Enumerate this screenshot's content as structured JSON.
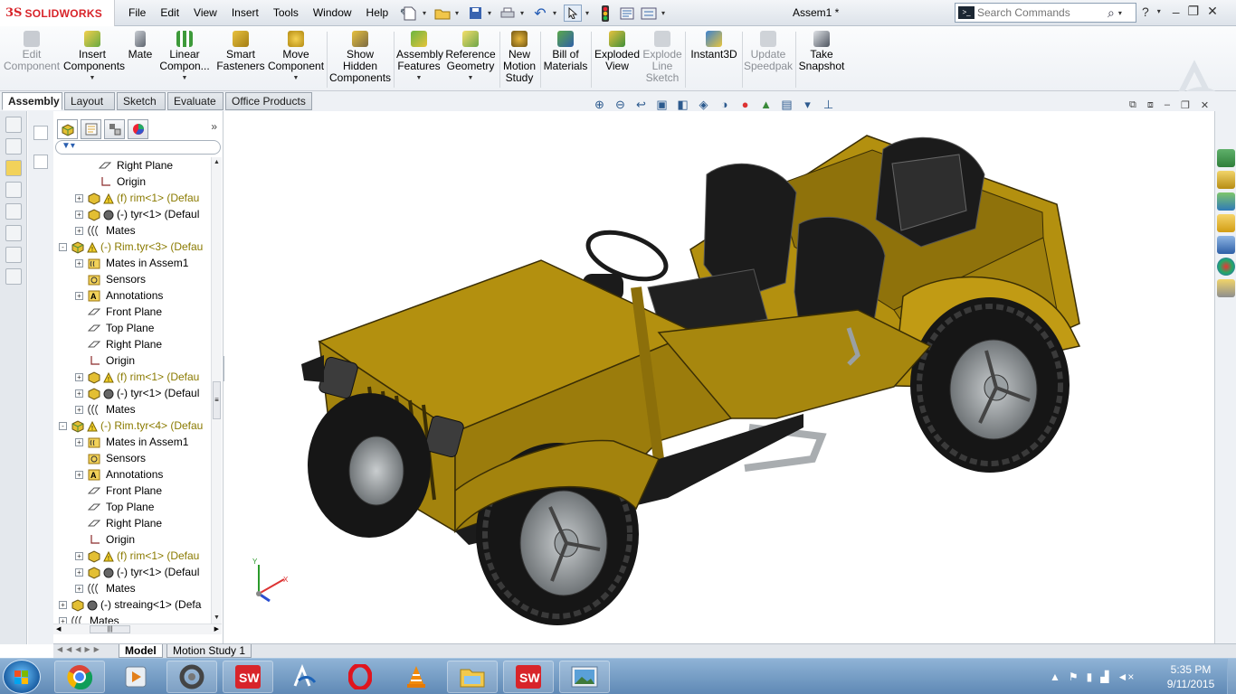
{
  "app": {
    "brand": "SOLIDWORKS",
    "logo_glyph": "3S",
    "document_title": "Assem1 *"
  },
  "menu": [
    "File",
    "Edit",
    "View",
    "Insert",
    "Tools",
    "Window",
    "Help"
  ],
  "search": {
    "placeholder": "Search Commands"
  },
  "ribbon": {
    "edit_component": [
      "Edit",
      "Component"
    ],
    "insert_components": [
      "Insert",
      "Components"
    ],
    "mate": [
      "Mate"
    ],
    "linear_component": [
      "Linear",
      "Compon..."
    ],
    "smart_fasteners": [
      "Smart",
      "Fasteners"
    ],
    "move_component": [
      "Move",
      "Component"
    ],
    "show_hidden": [
      "Show",
      "Hidden",
      "Components"
    ],
    "assembly_features": [
      "Assembly",
      "Features"
    ],
    "reference_geometry": [
      "Reference",
      "Geometry"
    ],
    "new_motion_study": [
      "New",
      "Motion",
      "Study"
    ],
    "bill_of_materials": [
      "Bill of",
      "Materials"
    ],
    "exploded_view": [
      "Exploded",
      "View"
    ],
    "explode_line_sketch": [
      "Explode",
      "Line",
      "Sketch"
    ],
    "instant3d": [
      "Instant3D"
    ],
    "update_speedpak": [
      "Update",
      "Speedpak"
    ],
    "take_snapshot": [
      "Take",
      "Snapshot"
    ]
  },
  "tabs": [
    "Assembly",
    "Layout",
    "Sketch",
    "Evaluate",
    "Office Products"
  ],
  "tree": [
    {
      "depth": 2,
      "exp": "",
      "icon": "plane",
      "label": "Right Plane",
      "warn": false
    },
    {
      "depth": 2,
      "exp": "",
      "icon": "origin",
      "label": "Origin",
      "warn": false
    },
    {
      "depth": 1,
      "exp": "+",
      "icon": "part-warn",
      "label": "(f) rim<1> (Defau",
      "warn": true
    },
    {
      "depth": 1,
      "exp": "+",
      "icon": "part-tyre",
      "label": "(-) tyr<1> (Defaul",
      "warn": false
    },
    {
      "depth": 1,
      "exp": "+",
      "icon": "mates",
      "label": "Mates",
      "warn": false
    },
    {
      "depth": 0,
      "exp": "-",
      "icon": "asm-warn",
      "label": "(-) Rim.tyr<3> (Defau",
      "warn": true
    },
    {
      "depth": 1,
      "exp": "+",
      "icon": "mates-folder",
      "label": "Mates in Assem1",
      "warn": false
    },
    {
      "depth": 1,
      "exp": "",
      "icon": "sensor",
      "label": "Sensors",
      "warn": false
    },
    {
      "depth": 1,
      "exp": "+",
      "icon": "annotation",
      "label": "Annotations",
      "warn": false
    },
    {
      "depth": 1,
      "exp": "",
      "icon": "plane",
      "label": "Front Plane",
      "warn": false
    },
    {
      "depth": 1,
      "exp": "",
      "icon": "plane",
      "label": "Top Plane",
      "warn": false
    },
    {
      "depth": 1,
      "exp": "",
      "icon": "plane",
      "label": "Right Plane",
      "warn": false
    },
    {
      "depth": 1,
      "exp": "",
      "icon": "origin",
      "label": "Origin",
      "warn": false
    },
    {
      "depth": 1,
      "exp": "+",
      "icon": "part-warn",
      "label": "(f) rim<1> (Defau",
      "warn": true
    },
    {
      "depth": 1,
      "exp": "+",
      "icon": "part-tyre",
      "label": "(-) tyr<1> (Defaul",
      "warn": false
    },
    {
      "depth": 1,
      "exp": "+",
      "icon": "mates",
      "label": "Mates",
      "warn": false
    },
    {
      "depth": 0,
      "exp": "-",
      "icon": "asm-warn",
      "label": "(-) Rim.tyr<4> (Defau",
      "warn": true
    },
    {
      "depth": 1,
      "exp": "+",
      "icon": "mates-folder",
      "label": "Mates in Assem1",
      "warn": false
    },
    {
      "depth": 1,
      "exp": "",
      "icon": "sensor",
      "label": "Sensors",
      "warn": false
    },
    {
      "depth": 1,
      "exp": "+",
      "icon": "annotation",
      "label": "Annotations",
      "warn": false
    },
    {
      "depth": 1,
      "exp": "",
      "icon": "plane",
      "label": "Front Plane",
      "warn": false
    },
    {
      "depth": 1,
      "exp": "",
      "icon": "plane",
      "label": "Top Plane",
      "warn": false
    },
    {
      "depth": 1,
      "exp": "",
      "icon": "plane",
      "label": "Right Plane",
      "warn": false
    },
    {
      "depth": 1,
      "exp": "",
      "icon": "origin",
      "label": "Origin",
      "warn": false
    },
    {
      "depth": 1,
      "exp": "+",
      "icon": "part-warn",
      "label": "(f) rim<1> (Defau",
      "warn": true
    },
    {
      "depth": 1,
      "exp": "+",
      "icon": "part-tyre",
      "label": "(-) tyr<1> (Defaul",
      "warn": false
    },
    {
      "depth": 1,
      "exp": "+",
      "icon": "mates",
      "label": "Mates",
      "warn": false
    },
    {
      "depth": 0,
      "exp": "+",
      "icon": "part-tyre",
      "label": "(-) streaing<1> (Defa",
      "warn": false
    },
    {
      "depth": 0,
      "exp": "+",
      "icon": "mates",
      "label": "Mates",
      "warn": false
    }
  ],
  "bottom_tabs": [
    "Model",
    "Motion Study 1"
  ],
  "triad_labels": {
    "y": "Y",
    "x": "X"
  },
  "taskbar": {
    "time": "5:35 PM",
    "date": "9/11/2015"
  },
  "colors": {
    "body": "#b3900f",
    "body_dark": "#7a5f06",
    "seat": "#1b1b1b",
    "tyre": "#161616",
    "rim": "#8e9396",
    "brand_red": "#d8242a"
  }
}
